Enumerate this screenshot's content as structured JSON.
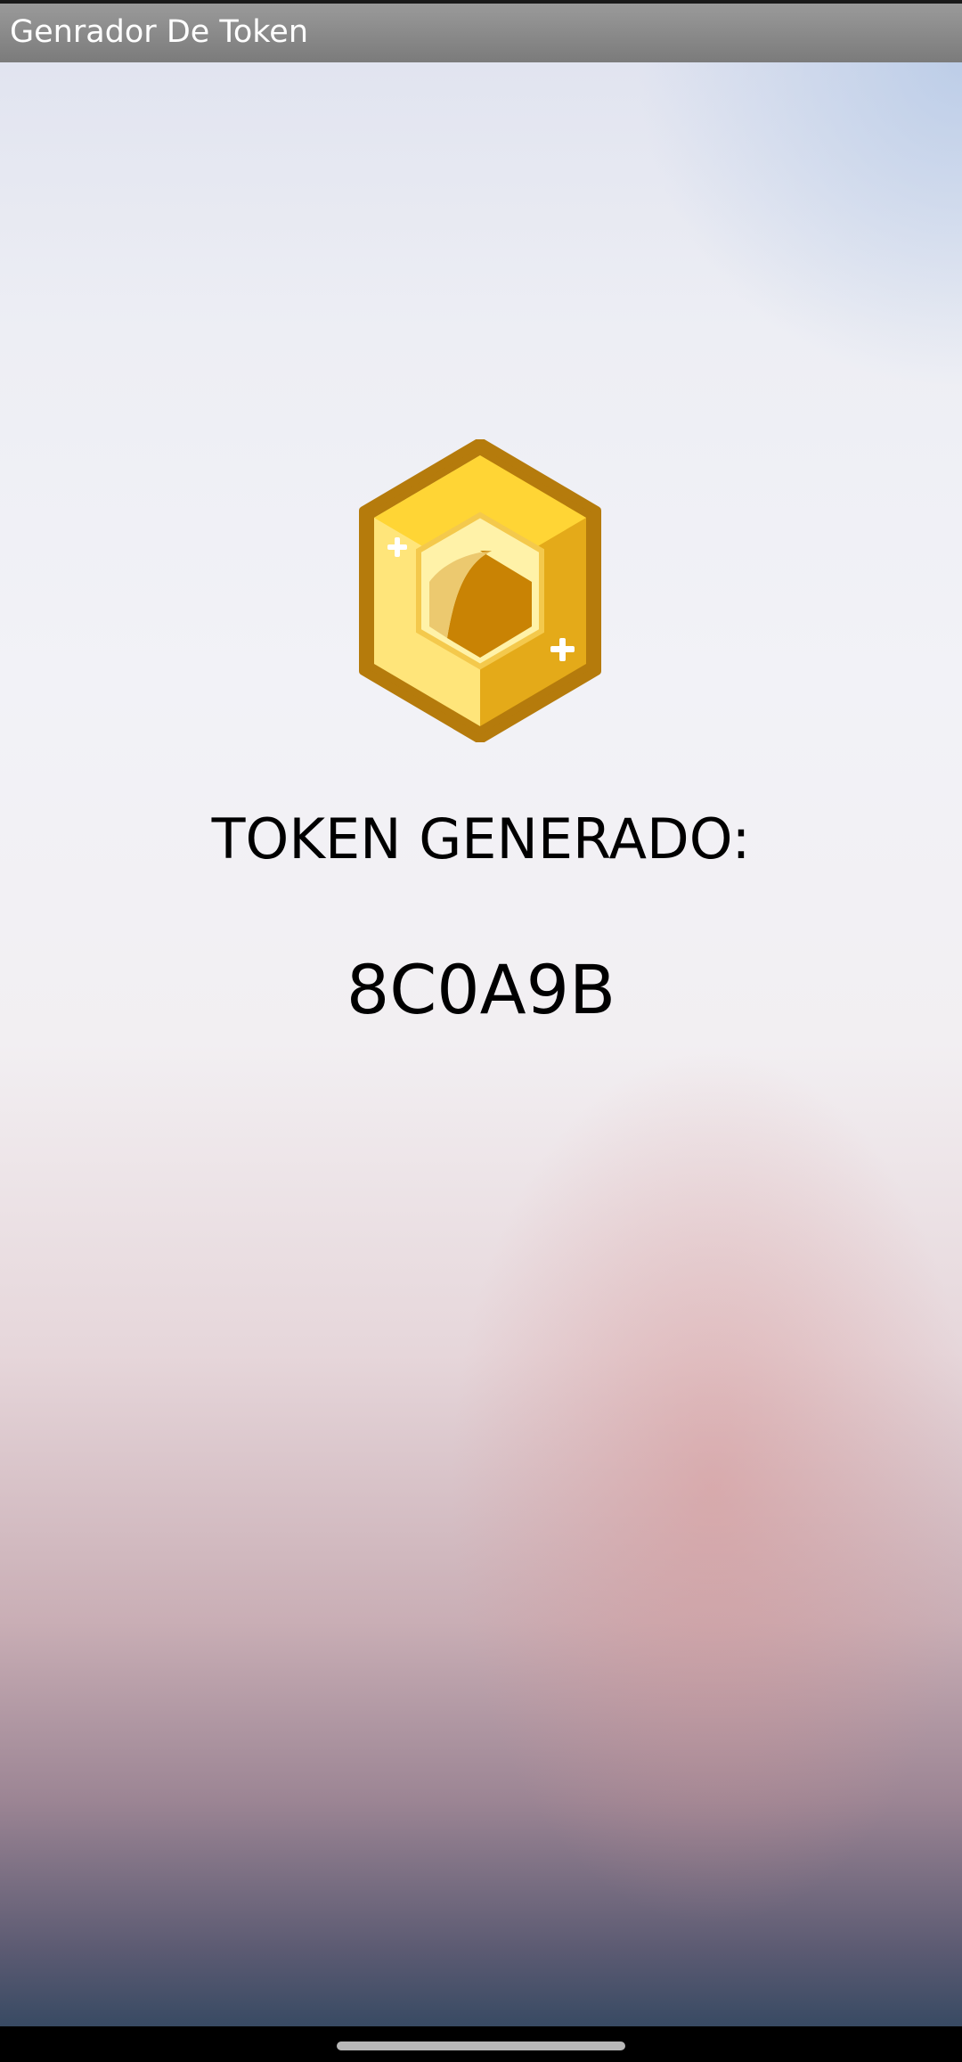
{
  "app": {
    "title": "Genrador De Token"
  },
  "main": {
    "token_label": "TOKEN GENERADO:",
    "token_value": "8C0A9B",
    "icon": "token-cube-icon"
  },
  "colors": {
    "title_bar": "#8a8a8a",
    "icon_outline": "#b57b0c",
    "icon_gold_light": "#ffe57a",
    "icon_gold_dark": "#e2a818",
    "text": "#000000"
  }
}
